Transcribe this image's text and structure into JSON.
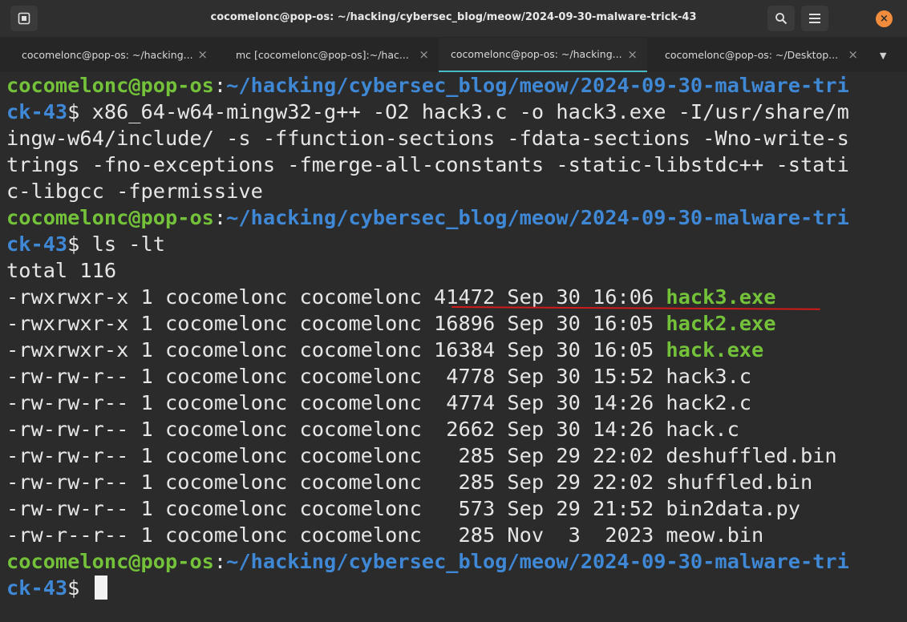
{
  "window": {
    "title": "cocomelonc@pop-os: ~/hacking/cybersec_blog/meow/2024-09-30-malware-trick-43",
    "close_glyph": "×"
  },
  "tabs": [
    {
      "label": "cocomelonc@pop-os: ~/hacking...",
      "active": false
    },
    {
      "label": "mc [cocomelonc@pop-os]:~/hac...",
      "active": false
    },
    {
      "label": "cocomelonc@pop-os: ~/hacking...",
      "active": true
    },
    {
      "label": "cocomelonc@pop-os: ~/Desktop...",
      "active": false
    }
  ],
  "tab_close_glyph": "×",
  "tab_dropdown_glyph": "▼",
  "colors": {
    "prompt_user": "#73c23a",
    "prompt_path": "#3f88d6",
    "executable": "#73c23a",
    "annotation": "#d11b1b",
    "tab_indicator": "#48b9c7"
  },
  "terminal": {
    "lines": [
      [
        {
          "t": "cocomelonc@pop-os",
          "c": "g"
        },
        {
          "t": ":"
        },
        {
          "t": "~/hacking/cybersec_blog/meow/2024-09-30-malware-tri",
          "c": "b"
        }
      ],
      [
        {
          "t": "ck-43",
          "c": "b"
        },
        {
          "t": "$ x86_64-w64-mingw32-g++ -O2 hack3.c -o hack3.exe -I/usr/share/m"
        }
      ],
      [
        {
          "t": "ingw-w64/include/ -s -ffunction-sections -fdata-sections -Wno-write-s"
        }
      ],
      [
        {
          "t": "trings -fno-exceptions -fmerge-all-constants -static-libstdc++ -stati"
        }
      ],
      [
        {
          "t": "c-libgcc -fpermissive"
        }
      ],
      [
        {
          "t": "cocomelonc@pop-os",
          "c": "g"
        },
        {
          "t": ":"
        },
        {
          "t": "~/hacking/cybersec_blog/meow/2024-09-30-malware-tri",
          "c": "b"
        }
      ],
      [
        {
          "t": "ck-43",
          "c": "b"
        },
        {
          "t": "$ ls -lt"
        }
      ],
      [
        {
          "t": "total 116"
        }
      ],
      [
        {
          "t": "-rwxrwxr-x 1 cocomelonc cocomelonc 41472 Sep 30 16:06 "
        },
        {
          "t": "hack3.exe",
          "c": "g"
        }
      ],
      [
        {
          "t": "-rwxrwxr-x 1 cocomelonc cocomelonc 16896 Sep 30 16:05 "
        },
        {
          "t": "hack2.exe",
          "c": "g"
        }
      ],
      [
        {
          "t": "-rwxrwxr-x 1 cocomelonc cocomelonc 16384 Sep 30 16:05 "
        },
        {
          "t": "hack.exe",
          "c": "g"
        }
      ],
      [
        {
          "t": "-rw-rw-r-- 1 cocomelonc cocomelonc  4778 Sep 30 15:52 hack3.c"
        }
      ],
      [
        {
          "t": "-rw-rw-r-- 1 cocomelonc cocomelonc  4774 Sep 30 14:26 hack2.c"
        }
      ],
      [
        {
          "t": "-rw-rw-r-- 1 cocomelonc cocomelonc  2662 Sep 30 14:26 hack.c"
        }
      ],
      [
        {
          "t": "-rw-rw-r-- 1 cocomelonc cocomelonc   285 Sep 29 22:02 deshuffled.bin"
        }
      ],
      [
        {
          "t": "-rw-rw-r-- 1 cocomelonc cocomelonc   285 Sep 29 22:02 shuffled.bin"
        }
      ],
      [
        {
          "t": "-rw-rw-r-- 1 cocomelonc cocomelonc   573 Sep 29 21:52 bin2data.py"
        }
      ],
      [
        {
          "t": "-rw-r--r-- 1 cocomelonc cocomelonc   285 Nov  3  2023 meow.bin"
        }
      ],
      [
        {
          "t": "cocomelonc@pop-os",
          "c": "g"
        },
        {
          "t": ":"
        },
        {
          "t": "~/hacking/cybersec_blog/meow/2024-09-30-malware-tri",
          "c": "b"
        }
      ],
      [
        {
          "t": "ck-43",
          "c": "b"
        },
        {
          "t": "$ "
        }
      ]
    ]
  }
}
